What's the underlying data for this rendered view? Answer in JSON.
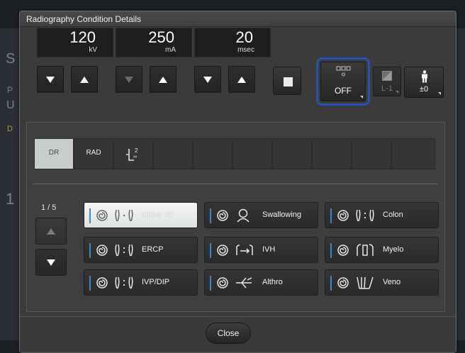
{
  "dialog": {
    "title": "Radiography Condition Details"
  },
  "readouts": [
    {
      "value": "120",
      "unit": "kV"
    },
    {
      "value": "250",
      "unit": "mA"
    },
    {
      "value": "20",
      "unit": "msec"
    }
  ],
  "controls": {
    "grid_label": "OFF",
    "lut_label": "L-1",
    "patient_label": "±0"
  },
  "modes": [
    "DR",
    "RAD"
  ],
  "pagination": {
    "label": "1 / 5"
  },
  "exams": [
    {
      "label": "Upper GI",
      "icon": "upper-gi",
      "selected": true
    },
    {
      "label": "Swallowing",
      "icon": "swallowing",
      "selected": false
    },
    {
      "label": "Colon",
      "icon": "colon",
      "selected": false
    },
    {
      "label": "ERCP",
      "icon": "ercp",
      "selected": false
    },
    {
      "label": "IVH",
      "icon": "ivh",
      "selected": false
    },
    {
      "label": "Myelo",
      "icon": "myelo",
      "selected": false
    },
    {
      "label": "IVP/DIP",
      "icon": "ivp-dip",
      "selected": false
    },
    {
      "label": "Althro",
      "icon": "althro",
      "selected": false
    },
    {
      "label": "Veno",
      "icon": "veno",
      "selected": false
    }
  ],
  "footer": {
    "close_label": "Close"
  },
  "background": {
    "letters": [
      "S",
      "P",
      "U",
      "D",
      "1"
    ]
  },
  "colors": {
    "accent_bar": "#3d86c9",
    "focus": "#2352b8"
  }
}
